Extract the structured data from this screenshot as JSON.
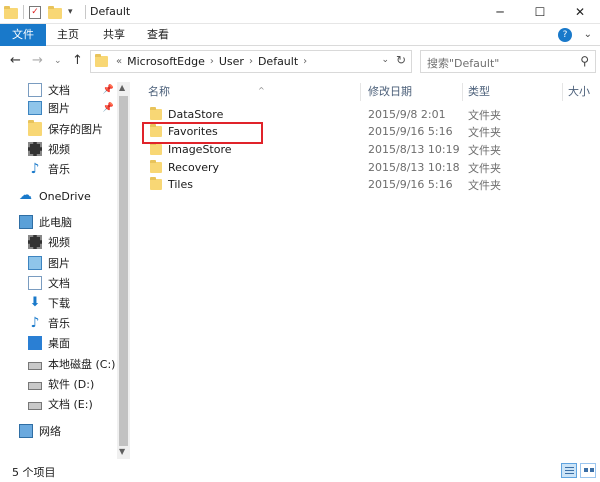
{
  "window": {
    "title": "Default"
  },
  "ribbon": {
    "tabs": [
      "文件",
      "主页",
      "共享",
      "查看"
    ]
  },
  "address": {
    "overflow": "«",
    "crumbs": [
      "MicrosoftEdge",
      "User",
      "Default"
    ]
  },
  "search": {
    "placeholder": "搜索\"Default\""
  },
  "sidebar": {
    "items": [
      {
        "label": "文档",
        "icon": "document-icon",
        "pinned": true
      },
      {
        "label": "图片",
        "icon": "pictures-icon",
        "pinned": true
      },
      {
        "label": "保存的图片",
        "icon": "folder-icon"
      },
      {
        "label": "视频",
        "icon": "videos-icon"
      },
      {
        "label": "音乐",
        "icon": "music-icon"
      },
      {
        "label": "OneDrive",
        "icon": "onedrive-icon"
      },
      {
        "label": "此电脑",
        "icon": "this-pc-icon"
      },
      {
        "label": "视频",
        "icon": "videos-icon"
      },
      {
        "label": "图片",
        "icon": "pictures-icon"
      },
      {
        "label": "文档",
        "icon": "document-icon"
      },
      {
        "label": "下载",
        "icon": "downloads-icon"
      },
      {
        "label": "音乐",
        "icon": "music-icon"
      },
      {
        "label": "桌面",
        "icon": "desktop-icon"
      },
      {
        "label": "本地磁盘 (C:)",
        "icon": "drive-icon"
      },
      {
        "label": "软件 (D:)",
        "icon": "drive-icon"
      },
      {
        "label": "文档 (E:)",
        "icon": "drive-icon"
      },
      {
        "label": "网络",
        "icon": "network-icon"
      }
    ]
  },
  "columns": {
    "name": "名称",
    "date": "修改日期",
    "type": "类型",
    "size": "大小"
  },
  "files": [
    {
      "name": "DataStore",
      "date": "2015/9/8 2:01",
      "type": "文件夹"
    },
    {
      "name": "Favorites",
      "date": "2015/9/16 5:16",
      "type": "文件夹"
    },
    {
      "name": "ImageStore",
      "date": "2015/8/13 10:19",
      "type": "文件夹"
    },
    {
      "name": "Recovery",
      "date": "2015/8/13 10:18",
      "type": "文件夹"
    },
    {
      "name": "Tiles",
      "date": "2015/9/16 5:16",
      "type": "文件夹"
    }
  ],
  "status": {
    "item_count": "5 个项目"
  },
  "colors": {
    "accent": "#1979ca",
    "highlight_box": "#e0232a",
    "folder": "#f8d775"
  }
}
